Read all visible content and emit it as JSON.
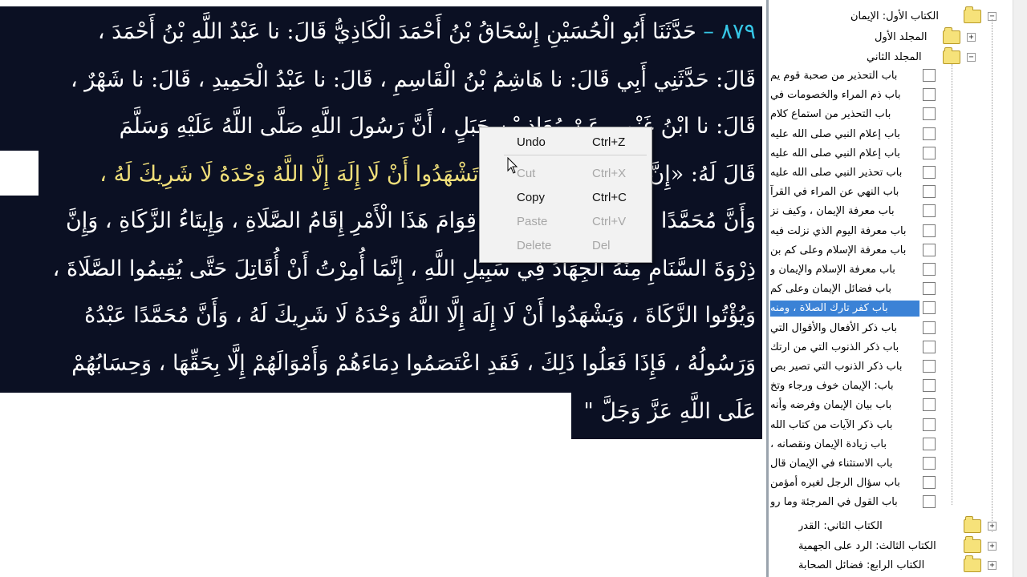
{
  "hadith_lines": [
    {
      "number": "٨٧٩ –",
      "text": " حَدَّثَنَا أَبُو الْحُسَيْنِ إِسْحَاقُ بْنُ أَحْمَدَ الْكَاذِيُّ قَالَ: نا عَبْدُ اللَّهِ بْنُ أَحْمَدَ ،",
      "highlight": ""
    },
    {
      "number": "",
      "text": "قَالَ: حَدَّثَنِي أَبِي قَالَ: نا هَاشِمُ بْنُ الْقَاسِمِ ، قَالَ: نا عَبْدُ الْحَمِيدِ ، قَالَ: نا شَهْرٌ ،",
      "highlight": ""
    },
    {
      "number": "",
      "text": "قَالَ: نا ابْنُ غَنْمٍ ، عَنْ مُعَاذِ بْنِ جَبَلٍ ، أَنَّ رَسُولَ اللَّهِ صَلَّى اللَّهُ عَلَيْهِ وَسَلَّمَ",
      "highlight": ""
    },
    {
      "number": "",
      "text": "قَالَ لَهُ: «إِنَّ رَأْسَ هَذَا الْأَمْرِ ",
      "highlight": "أَنْ تَشْهَدُوا أَنْ لَا إِلَهَ إِلَّا اللَّهُ وَحْدَهُ لَا شَرِيكَ لَهُ ،"
    },
    {
      "number": "",
      "text": "وَأَنَّ مُحَمَّدًا عَبْدُهُ وَرَسُولُهُ ، وَإِنَّ قِوَامَ هَذَا الْأَمْرِ إِقَامُ الصَّلَاةِ ، وَإِيتَاءُ الزَّكَاةِ ، وَإِنَّ",
      "highlight": ""
    },
    {
      "number": "",
      "text": "ذِرْوَةَ السَّنَامِ مِنْهُ الْجِهَادُ فِي سَبِيلِ اللَّهِ ، إِنَّمَا أُمِرْتُ أَنْ أُقَاتِلَ حَتَّى يُقِيمُوا الصَّلَاةَ ،",
      "highlight": ""
    },
    {
      "number": "",
      "text": "وَيُؤْتُوا الزَّكَاةَ ، وَيَشْهَدُوا أَنْ لَا إِلَهَ إِلَّا اللَّهُ وَحْدَهُ لَا شَرِيكَ لَهُ ، وَأَنَّ مُحَمَّدًا عَبْدُهُ",
      "highlight": ""
    },
    {
      "number": "",
      "text": "وَرَسُولُهُ ، فَإِذَا فَعَلُوا ذَلِكَ ، فَقَدِ اعْتَصَمُوا دِمَاءَهُمْ وَأَمْوَالَهُمْ إِلَّا بِحَقِّهَا ، وَحِسَابُهُمْ",
      "highlight": ""
    },
    {
      "number": "",
      "text": "عَلَى اللَّهِ عَزَّ وَجَلَّ \"",
      "highlight": ""
    }
  ],
  "context_menu": {
    "items": [
      {
        "label": "Undo",
        "shortcut": "Ctrl+Z",
        "enabled": true
      },
      {
        "label": "Cut",
        "shortcut": "Ctrl+X",
        "enabled": false
      },
      {
        "label": "Copy",
        "shortcut": "Ctrl+C",
        "enabled": true
      },
      {
        "label": "Paste",
        "shortcut": "Ctrl+V",
        "enabled": false
      },
      {
        "label": "Delete",
        "shortcut": "Del",
        "enabled": false
      }
    ]
  },
  "tree": {
    "book1": {
      "label": "الكتاب الأول: الإيمان",
      "expander": "−"
    },
    "vol1": {
      "label": "المجلد الأول",
      "expander": "+"
    },
    "vol2": {
      "label": "المجلد الثاني",
      "expander": "−"
    },
    "chapters": [
      "باب التحذير من صحبة قوم يم",
      "باب ذم المراء والخصومات في",
      "باب التحذير من استماع كلام",
      "باب إعلام النبي صلى الله عليه",
      "باب إعلام النبي صلى الله عليه",
      "باب تحذير النبي صلى الله عليه",
      "باب النهي عن المراء في القرآ",
      "باب معرفة الإيمان ، وكيف نز",
      "باب معرفة اليوم الذي نزلت فيه",
      "باب معرفة الإسلام وعلى كم بن",
      "باب معرفة الإسلام والإيمان و",
      "باب فضائل الإيمان وعلى كم",
      "باب كفر تارك الصلاة ، ومنه",
      "باب ذكر الأفعال والأقوال التي",
      "باب ذكر الذنوب التي من ارتك",
      "باب ذكر الذنوب التي تصير بص",
      "باب: الإيمان خوف ورجاء وتخ",
      "باب بيان الإيمان وفرضه وأنه",
      "باب ذكر الآيات من كتاب الله",
      "باب زيادة الإيمان ونقصانه ،",
      "باب الاستثناء في الإيمان قال",
      "باب سؤال الرجل لغيره أمؤمن",
      "باب القول في المرجئة وما رو"
    ],
    "selected_index": 12,
    "books_after": [
      {
        "label": "الكتاب الثاني: القدر",
        "expander": "+"
      },
      {
        "label": "الكتاب الثالث: الرد على الجهمية",
        "expander": "+"
      },
      {
        "label": "الكتاب الرابع: فضائل الصحابة",
        "expander": "+"
      }
    ]
  }
}
